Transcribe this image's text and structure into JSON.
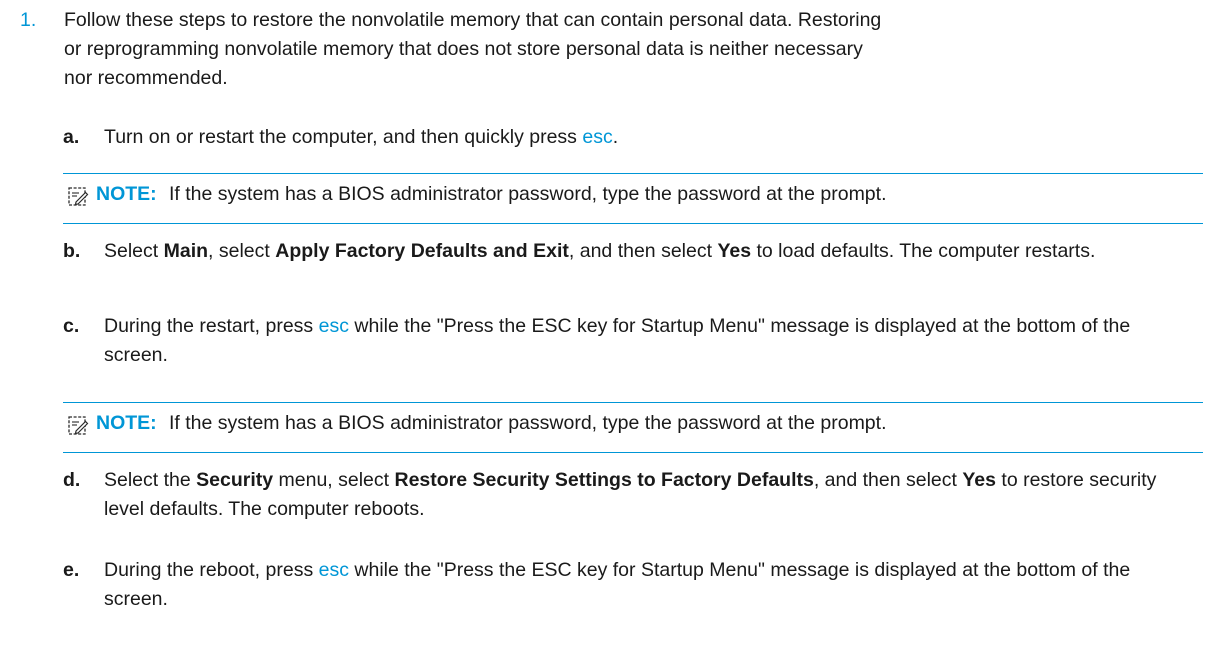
{
  "step": {
    "number": "1.",
    "text": "Follow these steps to restore the nonvolatile memory that can contain personal data. Restoring or reprogramming nonvolatile memory that does not store personal data is neither necessary nor recommended."
  },
  "substeps": {
    "a": {
      "letter": "a.",
      "t1": "Turn on or restart the computer, and then quickly press ",
      "key": "esc",
      "t2": "."
    },
    "b": {
      "letter": "b.",
      "t1": "Select ",
      "b1": "Main",
      "t2": ", select ",
      "b2": "Apply Factory Defaults and Exit",
      "t3": ", and then select ",
      "b3": "Yes",
      "t4": " to load defaults. The computer restarts."
    },
    "c": {
      "letter": "c.",
      "t1": "During the restart, press ",
      "key": "esc",
      "t2": " while the \"Press the ESC key for Startup Menu\" message is displayed at the bottom of the screen."
    },
    "d": {
      "letter": "d.",
      "t1": "Select the ",
      "b1": "Security",
      "t2": " menu, select ",
      "b2": "Restore Security Settings to Factory Defaults",
      "t3": ", and then select ",
      "b3": "Yes",
      "t4": " to restore security level defaults. The computer reboots."
    },
    "e": {
      "letter": "e.",
      "t1": "During the reboot, press ",
      "key": "esc",
      "t2": " while the \"Press the ESC key for Startup Menu\" message is displayed at the bottom of the screen."
    }
  },
  "notes": [
    {
      "label": "NOTE:",
      "text": "If the system has a BIOS administrator password, type the password at the prompt.",
      "icon": "note-pencil-icon"
    },
    {
      "label": "NOTE:",
      "text": "If the system has a BIOS administrator password, type the password at the prompt.",
      "icon": "note-pencil-icon"
    }
  ],
  "colors": {
    "accent": "#0096d6",
    "text": "#1a1a1a"
  }
}
